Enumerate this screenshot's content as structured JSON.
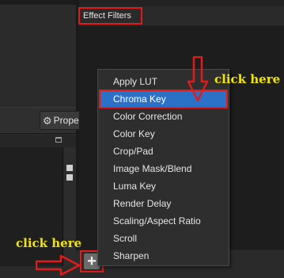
{
  "panel": {
    "properties_button_label": "Prope",
    "gear_icon": "⚙"
  },
  "filters": {
    "title": "Effect Filters",
    "add_button_glyph": "+"
  },
  "menu": {
    "items": [
      "Apply LUT",
      "Chroma Key",
      "Color Correction",
      "Color Key",
      "Crop/Pad",
      "Image Mask/Blend",
      "Luma Key",
      "Render Delay",
      "Scaling/Aspect Ratio",
      "Scroll",
      "Sharpen"
    ],
    "highlighted_index": 1
  },
  "annotations": {
    "top_label": "click here",
    "bottom_label": "click here"
  },
  "colors": {
    "highlight_blue": "#2c71c8",
    "annotation_red": "#e21a1a",
    "annotation_yellow": "#f2e600"
  }
}
